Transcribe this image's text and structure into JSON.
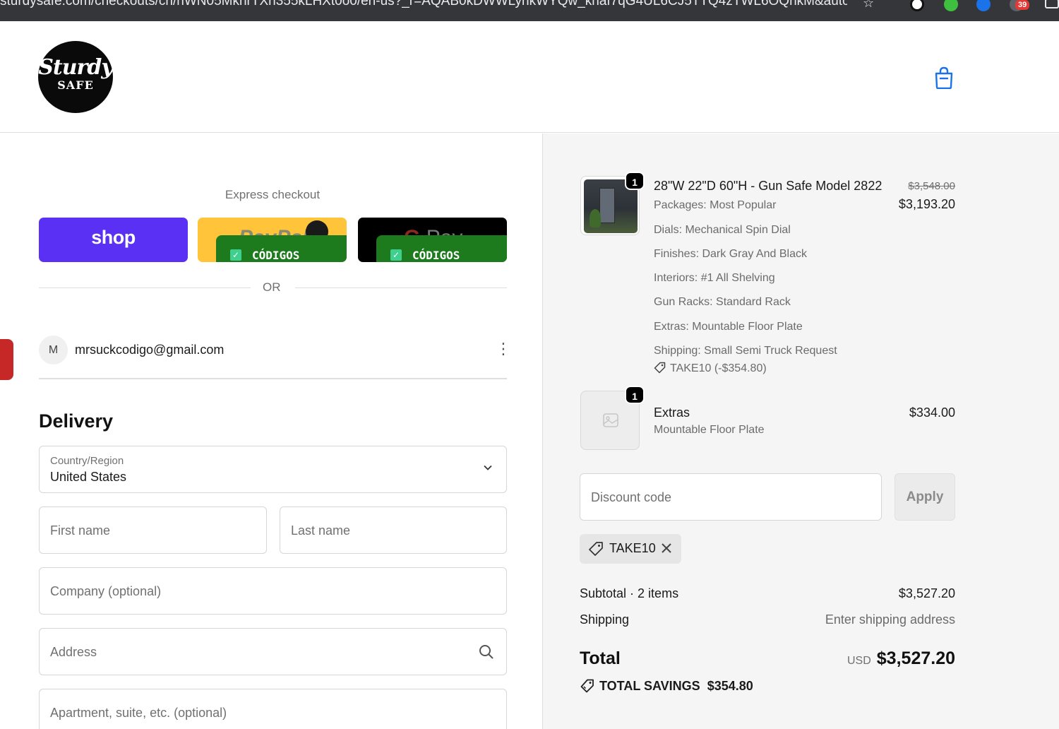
{
  "browser": {
    "url": "sturdysafe.com/checkouts/cn/hWN05MkhrTXh355kLHXt0o0/en-us?_r=AQAB0kDWWLynkWYQw_khaf7qG4UL6CJ5TTQ4zTWL6OQnkM&auto_re...",
    "extension_badge": "39"
  },
  "header": {
    "logo_line1": "Sturdy",
    "logo_line2": "SAFE"
  },
  "express": {
    "label": "Express checkout",
    "shop_label": "shop",
    "paypal_label": "PayPal",
    "gpay_label": "Pay",
    "codigos_label": "CÓDIGOS",
    "or_label": "OR"
  },
  "account": {
    "avatar_initial": "M",
    "email": "mrsuckcodigo@gmail.com"
  },
  "delivery": {
    "title": "Delivery",
    "country_label": "Country/Region",
    "country_value": "United States",
    "first_name_placeholder": "First name",
    "last_name_placeholder": "Last name",
    "company_placeholder": "Company (optional)",
    "address_placeholder": "Address",
    "apartment_placeholder": "Apartment, suite, etc. (optional)"
  },
  "order": {
    "items": [
      {
        "quantity": "1",
        "title": "28\"W 22\"D 60\"H - Gun Safe Model 2822",
        "original_price": "$3,548.00",
        "price": "$3,193.20",
        "attributes": [
          "Packages: Most Popular",
          "Dials: Mechanical Spin Dial",
          "Finishes: Dark Gray And Black",
          "Interiors: #1 All Shelving",
          "Gun Racks: Standard Rack",
          "Extras: Mountable Floor Plate",
          "Shipping: Small Semi Truck Request"
        ],
        "discount": "TAKE10 (-$354.80)"
      },
      {
        "quantity": "1",
        "title": "Extras",
        "subtitle": "Mountable Floor Plate",
        "price": "$334.00"
      }
    ],
    "discount_placeholder": "Discount code",
    "apply_label": "Apply",
    "applied_code": "TAKE10",
    "subtotal_label": "Subtotal · 2 items",
    "subtotal_value": "$3,527.20",
    "shipping_label": "Shipping",
    "shipping_value": "Enter shipping address",
    "total_label": "Total",
    "currency": "USD",
    "total_value": "$3,527.20",
    "savings_label": "TOTAL SAVINGS",
    "savings_value": "$354.80"
  },
  "colors": {
    "shop_purple": "#5a31f4",
    "paypal_yellow": "#ffc439",
    "gpay_black": "#000000",
    "accent_blue": "#1a73e8",
    "codigos_green": "#1d7a1d"
  },
  "icons": [
    "star-icon",
    "shopping-bag-icon",
    "more-vertical-icon",
    "chevron-down-icon",
    "search-icon",
    "tag-icon",
    "close-icon",
    "image-placeholder-icon",
    "savings-tag-icon",
    "check-icon"
  ]
}
